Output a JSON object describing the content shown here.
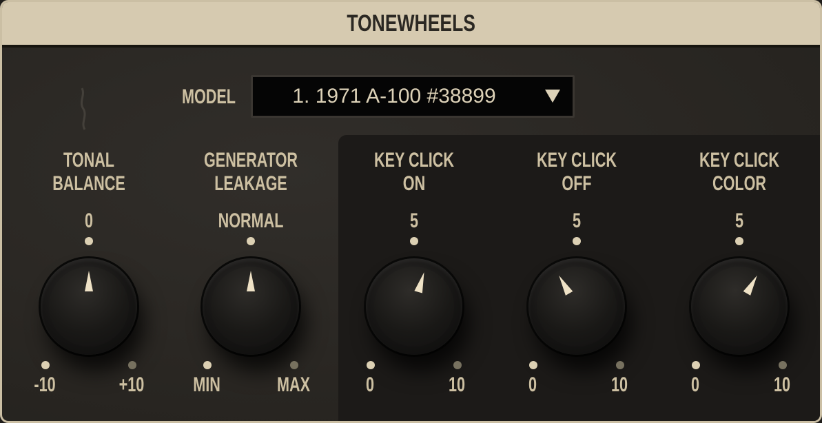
{
  "header": {
    "title": "TONEWHEELS"
  },
  "model": {
    "label": "MODEL",
    "value": "1. 1971 A-100 #38899",
    "icon": "chevron-down-icon"
  },
  "knobs": [
    {
      "title_line1": "TONAL",
      "title_line2": "BALANCE",
      "top_value": "0",
      "min_label": "-10",
      "max_label": "+10",
      "level": 0.5
    },
    {
      "title_line1": "GENERATOR",
      "title_line2": "LEAKAGE",
      "top_value": "NORMAL",
      "min_label": "MIN",
      "max_label": "MAX",
      "level": 0.5
    },
    {
      "title_line1": "KEY CLICK",
      "title_line2": "ON",
      "top_value": "5",
      "min_label": "0",
      "max_label": "10",
      "level": 5.6
    },
    {
      "title_line1": "KEY CLICK",
      "title_line2": "OFF",
      "top_value": "5",
      "min_label": "0",
      "max_label": "10",
      "level": 3.9
    },
    {
      "title_line1": "KEY CLICK",
      "title_line2": "COLOR",
      "top_value": "5",
      "min_label": "0",
      "max_label": "10",
      "level": 6.1
    }
  ],
  "colors": {
    "header_bg": "#d6cab0",
    "label": "#cdc0a2",
    "panel": "#2b2824",
    "pointer": "#efe2c6"
  }
}
